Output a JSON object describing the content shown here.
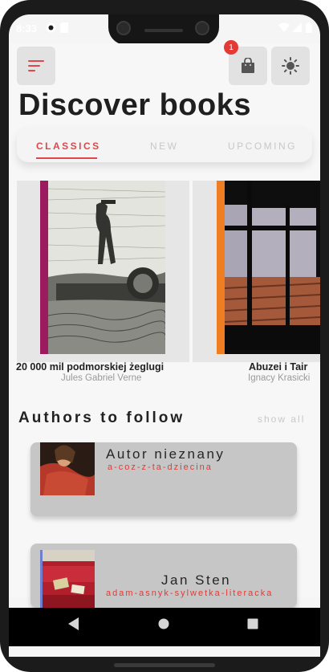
{
  "status_bar": {
    "time": "8:33"
  },
  "header": {
    "cart_badge": "1",
    "page_title": "Discover books"
  },
  "tabs": [
    {
      "label": "CLASSICS",
      "active": true
    },
    {
      "label": "NEW",
      "active": false
    },
    {
      "label": "UPCOMING",
      "active": false
    }
  ],
  "books": [
    {
      "title": "20 000 mil podmorskiej żeglugi",
      "author": "Jules Gabriel Verne",
      "spine_color": "#9c1a5e"
    },
    {
      "title": "Abuzei i Tair",
      "author": "Ignacy Krasicki",
      "spine_color": "#ef7d21"
    }
  ],
  "authors_section": {
    "title": "Authors to follow",
    "show_all": "show all"
  },
  "authors": [
    {
      "name": "Autor nieznany",
      "slug": "a-coz-z-ta-dziecina"
    },
    {
      "name": "Jan Sten",
      "slug": "adam-asnyk-sylwetka-literacka"
    }
  ],
  "icons": {
    "menu": "menu-lines-icon",
    "cart": "shopping-bag-icon",
    "theme": "sun-icon",
    "back": "back-triangle-icon",
    "home": "home-circle-icon",
    "recents": "recents-square-icon"
  },
  "colors": {
    "accent": "#e0474c",
    "badge": "#e53935"
  }
}
